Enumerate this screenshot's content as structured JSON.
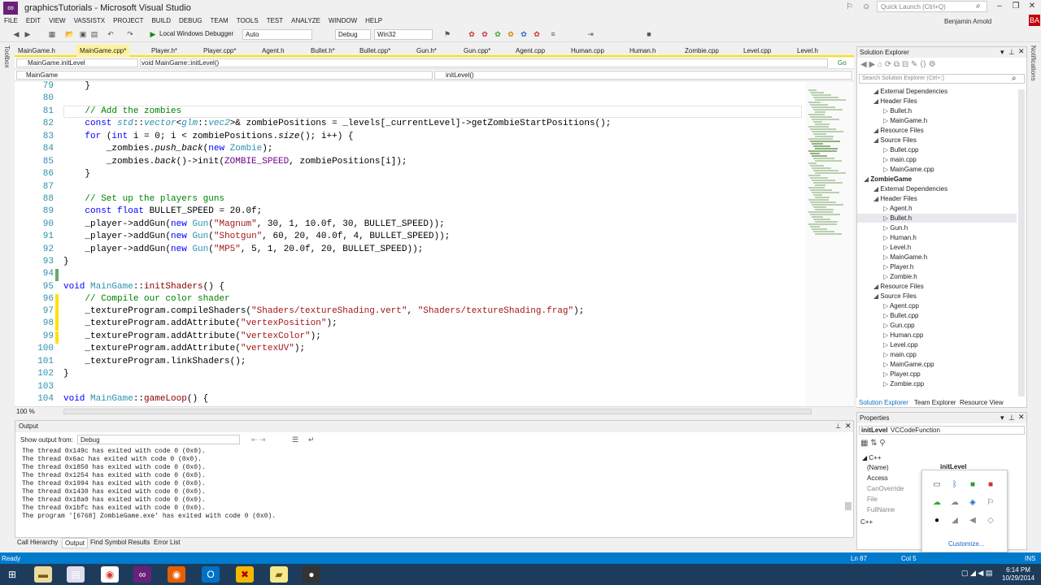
{
  "window": {
    "title": "graphicsTutorials - Microsoft Visual Studio",
    "quick_launch_placeholder": "Quick Launch (Ctrl+Q)",
    "user": "Benjamin Arnold",
    "user_initials": "BA"
  },
  "menu": [
    "FILE",
    "EDIT",
    "VIEW",
    "VASSISTX",
    "PROJECT",
    "BUILD",
    "DEBUG",
    "TEAM",
    "TOOLS",
    "TEST",
    "ANALYZE",
    "WINDOW",
    "HELP"
  ],
  "toolbar": {
    "debugger": "Local Windows Debugger",
    "config_auto": "Auto",
    "config": "Debug",
    "platform": "Win32"
  },
  "tabs": [
    "MainGame.h",
    "MainGame.cpp*",
    "Player.h*",
    "Player.cpp*",
    "Agent.h",
    "Bullet.h*",
    "Bullet.cpp*",
    "Gun.h*",
    "Gun.cpp*",
    "Agent.cpp",
    "Human.cpp",
    "Human.h",
    "Zombie.cpp",
    "Level.cpp",
    "Level.h"
  ],
  "nav": {
    "scope": "MainGame.initLevel",
    "func": "void MainGame::initLevel()",
    "class": "MainGame",
    "member": "initLevel()",
    "go": "Go"
  },
  "editor": {
    "line_numbers": [
      "79",
      "80",
      "81",
      "82",
      "83",
      "84",
      "85",
      "86",
      "87",
      "88",
      "89",
      "90",
      "91",
      "92",
      "93",
      "94",
      "95",
      "96",
      "97",
      "98",
      "99",
      "100",
      "101",
      "102",
      "103",
      "104"
    ],
    "zoom": "100 %"
  },
  "output": {
    "title": "Output",
    "show_from_label": "Show output from:",
    "source": "Debug",
    "lines": [
      "The thread 0x149c has exited with code 0 (0x0).",
      "The thread 0x6ac has exited with code 0 (0x0).",
      "The thread 0x1850 has exited with code 0 (0x0).",
      "The thread 0x1254 has exited with code 0 (0x0).",
      "The thread 0x1994 has exited with code 0 (0x0).",
      "The thread 0x1430 has exited with code 0 (0x0).",
      "The thread 0x18a0 has exited with code 0 (0x0).",
      "The thread 0x1bfc has exited with code 0 (0x0).",
      "The program '[6768] ZombieGame.exe' has exited with code 0 (0x0)."
    ]
  },
  "bottom_tabs": [
    "Call Hierarchy",
    "Output",
    "Find Symbol Results",
    "Error List"
  ],
  "solution_explorer": {
    "title": "Solution Explorer",
    "search_placeholder": "Search Solution Explorer (Ctrl+;)",
    "tree": [
      {
        "indent": 2,
        "label": "External Dependencies"
      },
      {
        "indent": 2,
        "label": "Header Files"
      },
      {
        "indent": 3,
        "label": "Bullet.h"
      },
      {
        "indent": 3,
        "label": "MainGame.h"
      },
      {
        "indent": 2,
        "label": "Resource Files"
      },
      {
        "indent": 2,
        "label": "Source Files"
      },
      {
        "indent": 3,
        "label": "Bullet.cpp"
      },
      {
        "indent": 3,
        "label": "main.cpp"
      },
      {
        "indent": 3,
        "label": "MainGame.cpp"
      },
      {
        "indent": 1,
        "label": "ZombieGame"
      },
      {
        "indent": 2,
        "label": "External Dependencies"
      },
      {
        "indent": 2,
        "label": "Header Files"
      },
      {
        "indent": 3,
        "label": "Agent.h"
      },
      {
        "indent": 3,
        "label": "Bullet.h"
      },
      {
        "indent": 3,
        "label": "Gun.h"
      },
      {
        "indent": 3,
        "label": "Human.h"
      },
      {
        "indent": 3,
        "label": "Level.h"
      },
      {
        "indent": 3,
        "label": "MainGame.h"
      },
      {
        "indent": 3,
        "label": "Player.h"
      },
      {
        "indent": 3,
        "label": "Zombie.h"
      },
      {
        "indent": 2,
        "label": "Resource Files"
      },
      {
        "indent": 2,
        "label": "Source Files"
      },
      {
        "indent": 3,
        "label": "Agent.cpp"
      },
      {
        "indent": 3,
        "label": "Bullet.cpp"
      },
      {
        "indent": 3,
        "label": "Gun.cpp"
      },
      {
        "indent": 3,
        "label": "Human.cpp"
      },
      {
        "indent": 3,
        "label": "Level.cpp"
      },
      {
        "indent": 3,
        "label": "main.cpp"
      },
      {
        "indent": 3,
        "label": "MainGame.cpp"
      },
      {
        "indent": 3,
        "label": "Player.cpp"
      },
      {
        "indent": 3,
        "label": "Zombie.cpp"
      }
    ],
    "tabs": [
      "Solution Explorer",
      "Team Explorer",
      "Resource View"
    ]
  },
  "properties": {
    "title": "Properties",
    "object": "initLevel",
    "object_type": "VCCodeFunction",
    "category": "C++",
    "rows": [
      "(Name)",
      "Access",
      "CanOverride",
      "File",
      "FullName"
    ],
    "name_value": "initLevel",
    "footer": "C++",
    "customize": "Customize..."
  },
  "status": {
    "ready": "Ready",
    "line": "Ln 87",
    "col": "Col 5",
    "mode": "INS"
  },
  "clock": {
    "time": "6:14 PM",
    "date": "10/29/2014"
  }
}
